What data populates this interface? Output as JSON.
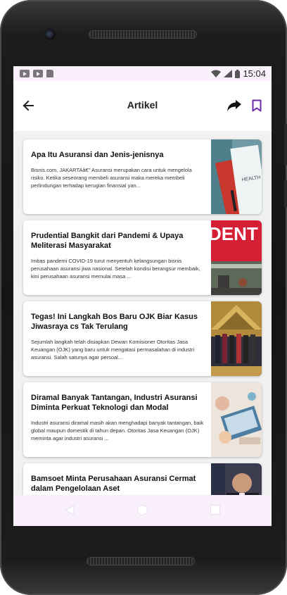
{
  "status_bar": {
    "time": "15:04",
    "left_icons": [
      "youtube-icon",
      "youtube-icon",
      "sd-card-icon"
    ],
    "right_icons": [
      "wifi-icon",
      "signal-icon",
      "battery-icon"
    ]
  },
  "app_bar": {
    "title": "Artikel",
    "back_icon": "arrow-back-icon",
    "share_icon": "share-icon",
    "bookmark_icon": "bookmark-icon",
    "accent_color": "#6a2aa6"
  },
  "articles": [
    {
      "title": "Apa Itu Asuransi dan Jenis-jenisnya",
      "snippet": "Bisnis.com, JAKARTAâ€\" Asuransi merupakan cara untuk mengelola risiko. Ketika seseorang membeli asuransi maka mereka membeli perlindungan terhadap kerugian finansial yan...",
      "image": "health-insurance-photo"
    },
    {
      "title": "Prudential Bangkit dari Pandemi & Upaya Meliterasi Masyarakat",
      "snippet": "Imbas pandemi COVID-19 turut menyentuh kelangsungan bisnis perusahaan asuransi jiwa nasional. Setelah kondisi berangsur membaik, kini perusahaan asuransi memulai masa ...",
      "image": "prudential-building-photo",
      "image_text": "DENT"
    },
    {
      "title": "Tegas! Ini Langkah Bos Baru OJK Biar Kasus Jiwasraya cs Tak Terulang",
      "snippet": "Sejumlah langkah telah disiapkan Dewan Komisioner Otoritas Jasa Keuangan (OJK) yang baru untuk mengatasi permasalahan di industri asuransi. Salah satunya agar persoal...",
      "image": "ojk-officials-photo"
    },
    {
      "title": "Diramal Banyak Tantangan, Industri Asuransi Diminta Perkuat Teknologi dan Modal",
      "snippet": "Industri asuransi diramal masih akan menghadapi banyak tantangan, baik global maupun domestik di tahun depan. Otoritas Jasa Keuangan (OJK) meminta agar industri asuransi ...",
      "image": "laptop-work-photo"
    },
    {
      "title": "Bamsoet Minta Perusahaan Asuransi Cermat dalam Pengelolaan Aset",
      "snippet": "",
      "image": "bamsoet-portrait-photo"
    }
  ],
  "nav_bar": {
    "buttons": [
      "back-triangle-icon",
      "home-circle-icon",
      "recents-square-icon"
    ]
  }
}
